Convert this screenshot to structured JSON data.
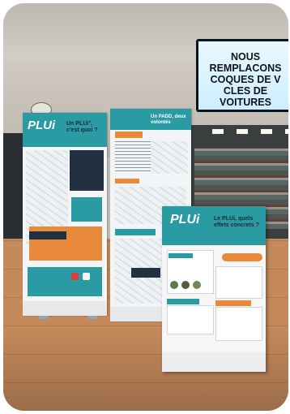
{
  "sign": {
    "lines": [
      "NOUS",
      "REMPLACONS",
      "COQUES DE V",
      "CLES DE",
      "VOITURES"
    ]
  },
  "banner_left": {
    "logo": "PLUi",
    "question": "Un PLUi°, c'est quoi ?"
  },
  "banner_middle": {
    "title": "Un PADD, deux volontés"
  },
  "banner_right": {
    "logo": "PLUi",
    "question": "Le PLUi, quels effets concrets ?"
  },
  "colors": {
    "teal": "#2a9aa3",
    "orange": "#e88a3a",
    "navy": "#223142"
  }
}
